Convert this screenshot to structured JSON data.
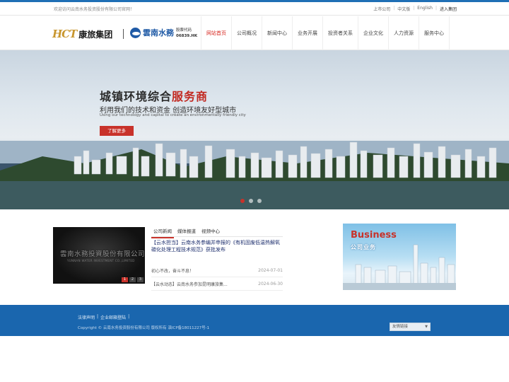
{
  "topbar": {
    "welcome": "欢迎访问云南水务投资股份有限公司官网！",
    "links": [
      "上市公司",
      "中文版",
      "English",
      "进入集团"
    ]
  },
  "header": {
    "logo_hct_mark": "HCT",
    "logo_hct_name": "康旅集团",
    "logo_yn_name": "雲南水務",
    "stock_label": "股票代码",
    "stock_code": "06839.HK"
  },
  "nav": {
    "items": [
      "网站首页",
      "公司概况",
      "新闻中心",
      "业务开展",
      "投资者关系",
      "企业文化",
      "人力资源",
      "服务中心"
    ],
    "active_index": 0
  },
  "banner": {
    "title_main": "城镇环境综合",
    "title_highlight": "服务商",
    "subtitle": "利用我们的技术和资金  创造环境友好型城市",
    "subtitle_en": "Using our technology and capital to create an environmentally friendly city",
    "button": "了解更多"
  },
  "news": {
    "image_plaque": "雲南水務投資股份有限公司",
    "image_plaque_en": "YUNNAN WATER INVESTMENT CO.,LIMITED",
    "slide_numbers": [
      "1",
      "2",
      "3"
    ],
    "tabs": [
      "公司新闻",
      "媒体报道",
      "视频中心"
    ],
    "headline": "【云水担当】云南水务参编并申报的《有机固废低温热解氧碳化处理工程技术规范》获批发布",
    "items": [
      {
        "title": "初心不改，奋斗不息！",
        "date": "2024-07-01"
      },
      {
        "title": "【云水动态】云南水务参加昆明康旅集...",
        "date": "2024-06-30"
      }
    ]
  },
  "business": {
    "title_en": "Business",
    "title_cn": "公司业务"
  },
  "footer": {
    "links": [
      "法律声明",
      "企业邮箱登陆"
    ],
    "copyright": "Copyright © 云南水务投资股份有限公司  版权所有  滇ICP备18011227号-1",
    "select_label": "友情链接"
  },
  "colors": {
    "brand_blue": "#1a66ae",
    "accent_red": "#c8322a",
    "hct_gold": "#c8962e"
  }
}
